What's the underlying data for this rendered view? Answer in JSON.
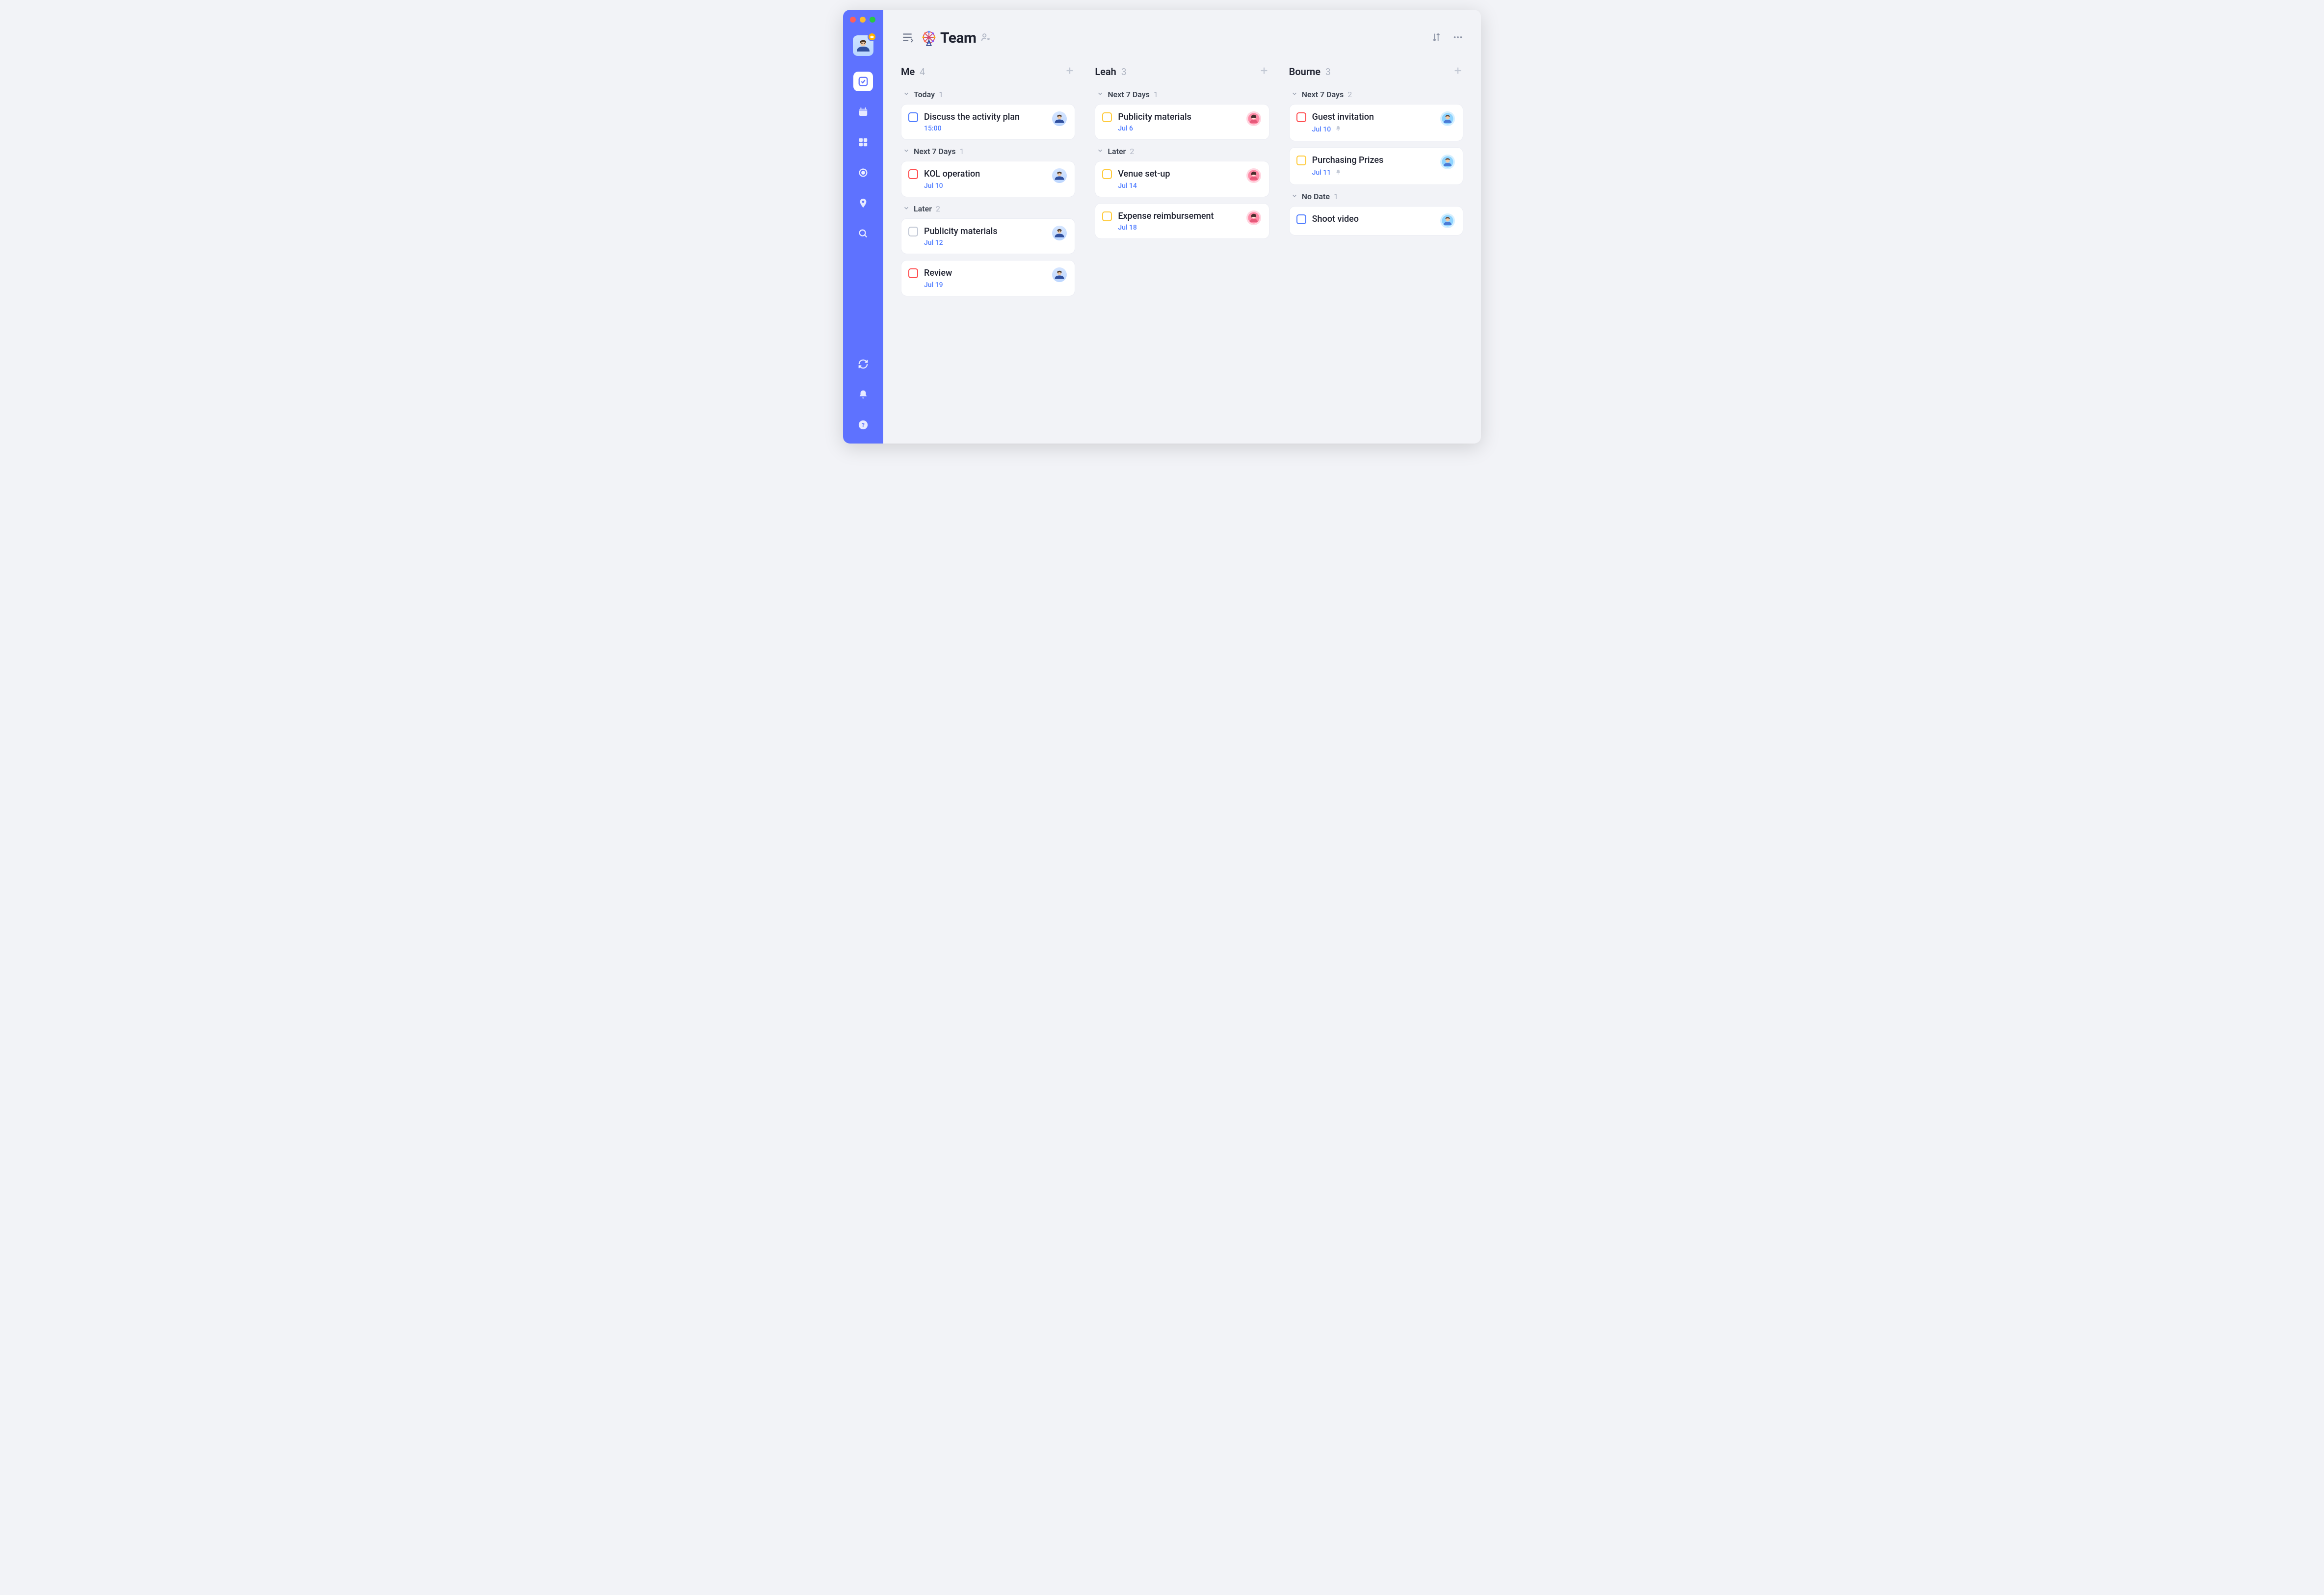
{
  "page": {
    "title": "Team",
    "list_icon": "ferris-wheel"
  },
  "columns": [
    {
      "name": "Me",
      "count": 4,
      "assignee": "me",
      "sections": [
        {
          "title": "Today",
          "count": 1,
          "tasks": [
            {
              "title": "Discuss the activity plan",
              "date": "15:00",
              "priority": "low",
              "reminder": false
            }
          ]
        },
        {
          "title": "Next 7 Days",
          "count": 1,
          "tasks": [
            {
              "title": "KOL operation",
              "date": "Jul 10",
              "priority": "high",
              "reminder": false
            }
          ]
        },
        {
          "title": "Later",
          "count": 2,
          "tasks": [
            {
              "title": "Publicity materials",
              "date": "Jul 12",
              "priority": "none",
              "reminder": false
            },
            {
              "title": "Review",
              "date": "Jul 19",
              "priority": "high",
              "reminder": false
            }
          ]
        }
      ]
    },
    {
      "name": "Leah",
      "count": 3,
      "assignee": "leah",
      "sections": [
        {
          "title": "Next 7 Days",
          "count": 1,
          "tasks": [
            {
              "title": "Publicity materials",
              "date": "Jul 6",
              "priority": "medium",
              "reminder": false
            }
          ]
        },
        {
          "title": "Later",
          "count": 2,
          "tasks": [
            {
              "title": "Venue set-up",
              "date": "Jul 14",
              "priority": "medium",
              "reminder": false
            },
            {
              "title": "Expense reimbursement",
              "date": "Jul 18",
              "priority": "medium",
              "reminder": false
            }
          ]
        }
      ]
    },
    {
      "name": "Bourne",
      "count": 3,
      "assignee": "bourne",
      "sections": [
        {
          "title": "Next 7 Days",
          "count": 2,
          "tasks": [
            {
              "title": "Guest invitation",
              "date": "Jul 10",
              "priority": "high",
              "reminder": true
            },
            {
              "title": "Purchasing Prizes",
              "date": "Jul 11",
              "priority": "medium",
              "reminder": true
            }
          ]
        },
        {
          "title": "No Date",
          "count": 1,
          "tasks": [
            {
              "title": "Shoot video",
              "date": "",
              "priority": "low",
              "reminder": false
            }
          ]
        }
      ]
    }
  ]
}
